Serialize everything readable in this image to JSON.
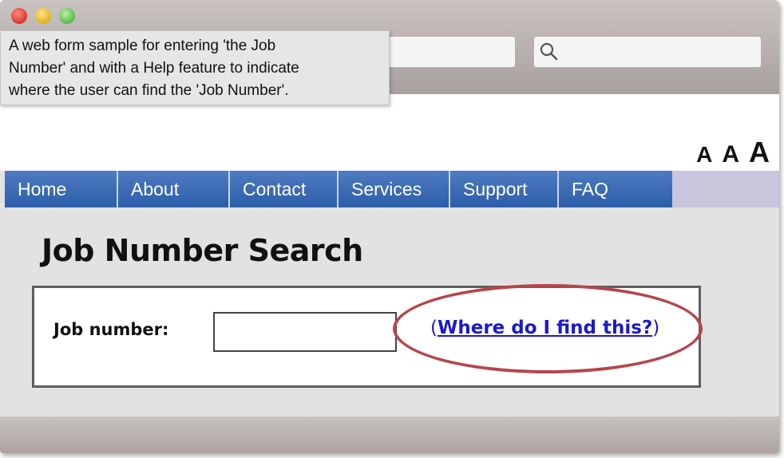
{
  "tooltip": {
    "lines": [
      "A web form sample for entering 'the Job",
      "Number' and with a Help feature to indicate",
      "where the user can find the 'Job Number'."
    ]
  },
  "font_size_controls": [
    "A",
    "A",
    "A"
  ],
  "nav": {
    "items": [
      {
        "label": "Home"
      },
      {
        "label": "About"
      },
      {
        "label": "Contact"
      },
      {
        "label": "Services"
      },
      {
        "label": "Support"
      },
      {
        "label": "FAQ"
      }
    ]
  },
  "page": {
    "title": "Job Number Search"
  },
  "form": {
    "job_label": "Job number:",
    "job_value": "",
    "help_open": "(",
    "help_link": "Where do I find this?",
    "help_close": ")"
  },
  "colors": {
    "nav_blue": "#2c5ea8",
    "link_blue": "#1a1acc",
    "highlight_ring": "#b5464b"
  },
  "icons": [
    "search-icon"
  ]
}
